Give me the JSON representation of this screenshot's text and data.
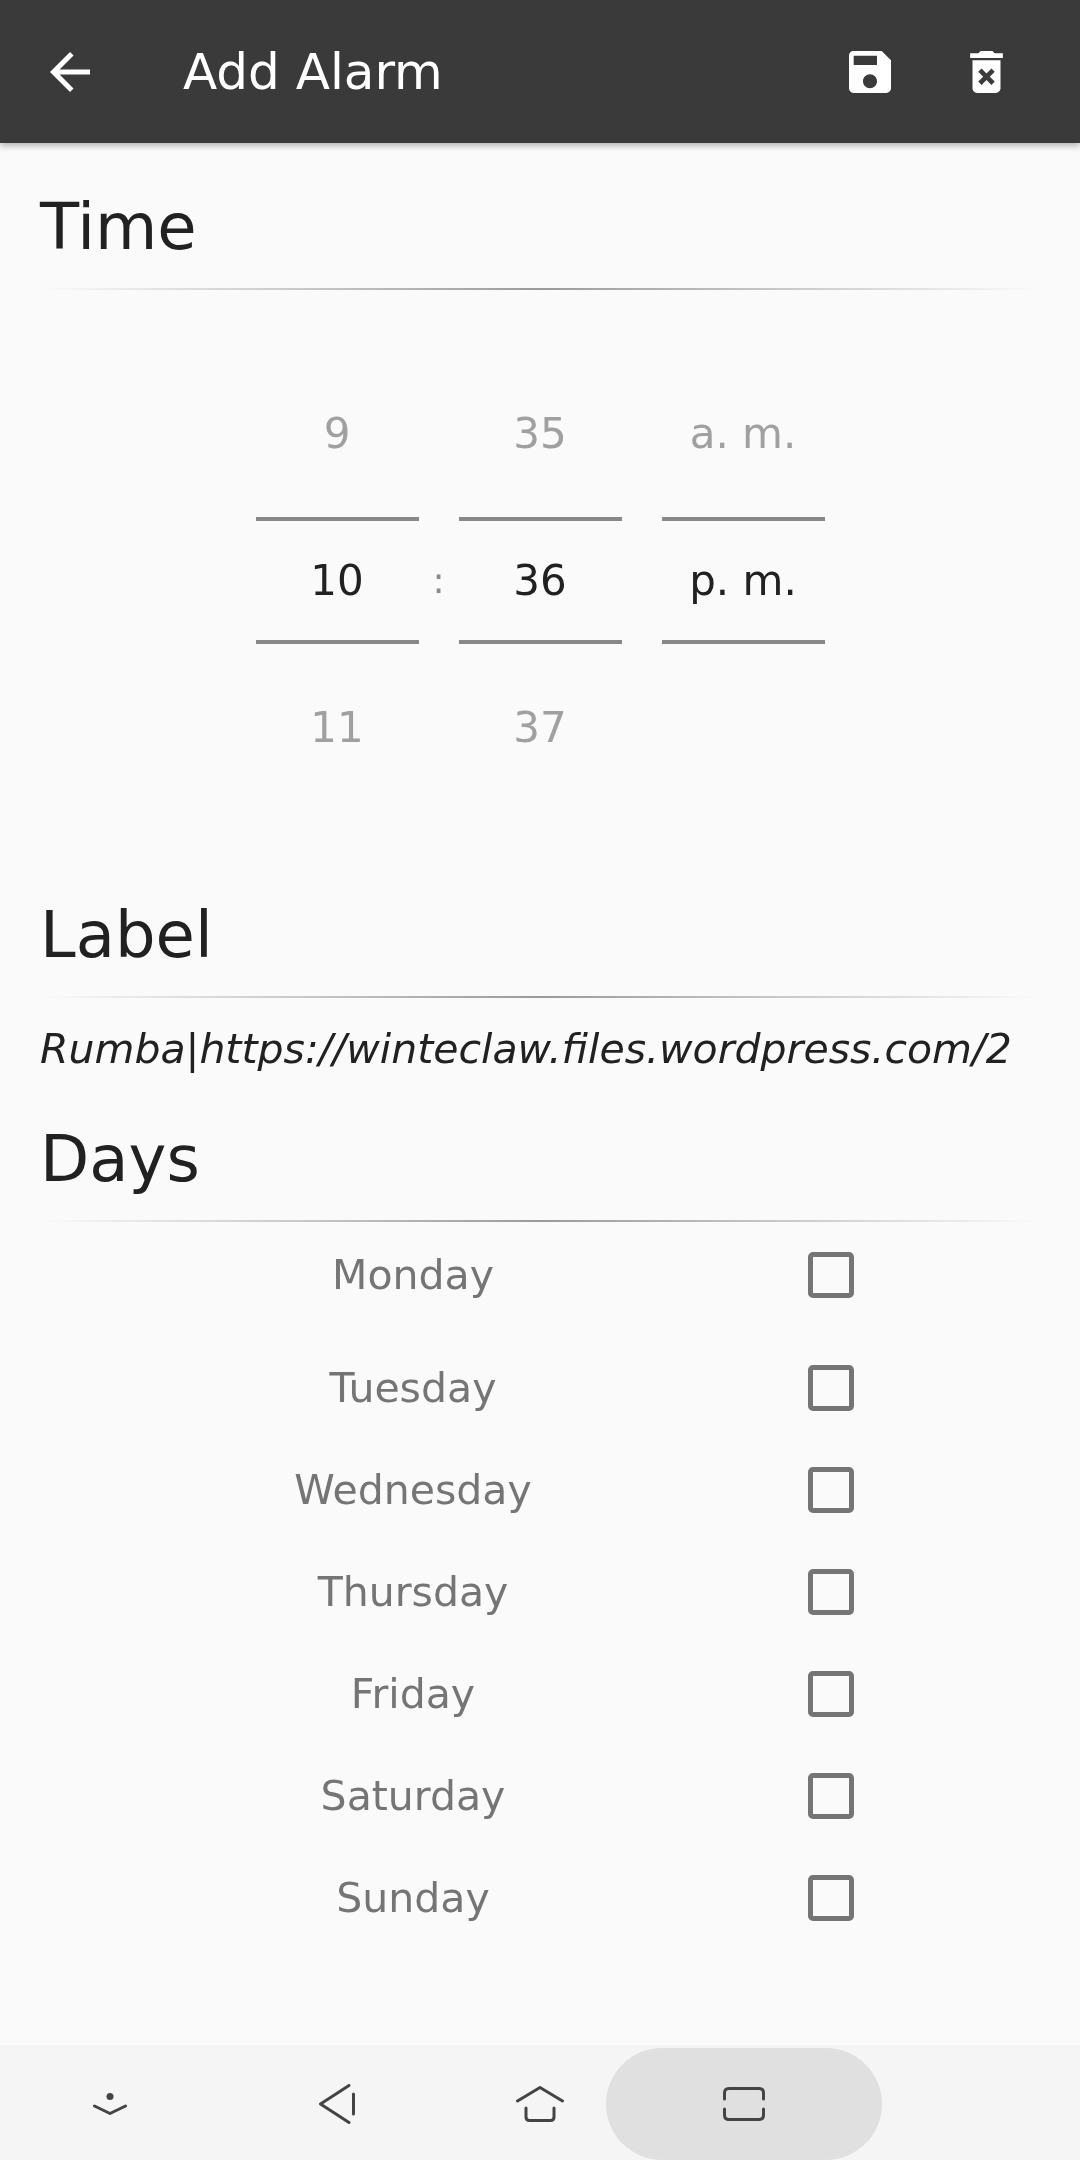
{
  "app_bar": {
    "title": "Add Alarm"
  },
  "time": {
    "heading": "Time",
    "separator": ":",
    "columns": [
      {
        "items": [
          {
            "text": "9",
            "selected": false
          },
          {
            "text": "10",
            "selected": true
          },
          {
            "text": "11",
            "selected": false
          }
        ]
      },
      {
        "items": [
          {
            "text": "35",
            "selected": false
          },
          {
            "text": "36",
            "selected": true
          },
          {
            "text": "37",
            "selected": false
          }
        ]
      },
      {
        "items": [
          {
            "text": "a. m.",
            "selected": false
          },
          {
            "text": "p. m.",
            "selected": true
          }
        ]
      }
    ]
  },
  "label": {
    "heading": "Label",
    "value": "Rumba|https://winteclaw.files.wordpress.com/2"
  },
  "days": {
    "heading": "Days",
    "items": [
      {
        "name": "Monday",
        "checked": false
      },
      {
        "name": "Tuesday",
        "checked": false
      },
      {
        "name": "Wednesday",
        "checked": false
      },
      {
        "name": "Thursday",
        "checked": false
      },
      {
        "name": "Friday",
        "checked": false
      },
      {
        "name": "Saturday",
        "checked": false
      },
      {
        "name": "Sunday",
        "checked": false
      }
    ]
  },
  "nav_bar": {
    "buttons": [
      {
        "kind": "keyboard",
        "selected": false
      },
      {
        "kind": "back",
        "selected": false
      },
      {
        "kind": "home",
        "selected": false
      },
      {
        "kind": "recents",
        "selected": true
      }
    ]
  }
}
